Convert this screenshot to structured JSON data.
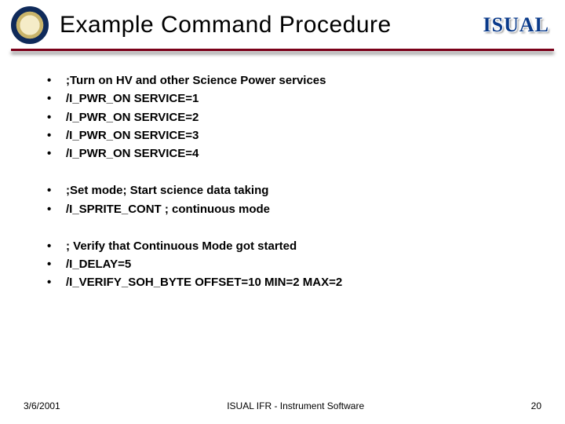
{
  "header": {
    "title": "Example Command Procedure",
    "logo_text": "ISUAL"
  },
  "groups": [
    {
      "lines": [
        ";Turn on HV and other Science Power services",
        "/I_PWR_ON SERVICE=1",
        "/I_PWR_ON SERVICE=2",
        "/I_PWR_ON SERVICE=3",
        "/I_PWR_ON SERVICE=4"
      ]
    },
    {
      "lines": [
        ";Set mode; Start science data taking",
        "/I_SPRITE_CONT  ; continuous mode"
      ]
    },
    {
      "lines": [
        "; Verify that Continuous Mode got started",
        "/I_DELAY=5",
        "/I_VERIFY_SOH_BYTE OFFSET=10 MIN=2 MAX=2"
      ]
    }
  ],
  "footer": {
    "date": "3/6/2001",
    "center": "ISUAL IFR - Instrument Software",
    "page": "20"
  }
}
